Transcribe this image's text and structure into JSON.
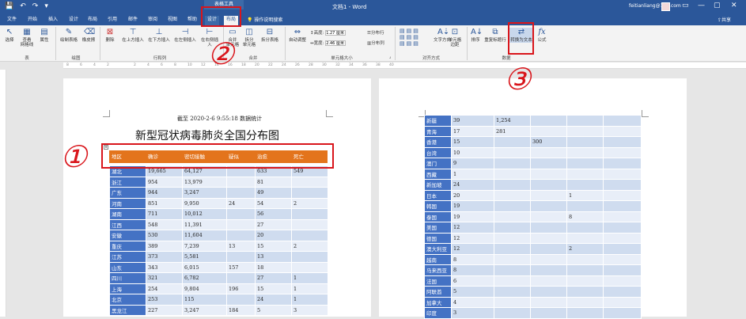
{
  "titlebar": {
    "quick": [
      "💾",
      "↶",
      "↷",
      "▾"
    ],
    "context_label": "表格工具",
    "doc_title": "文档1 - Word",
    "user": "feitianliang@163.com",
    "controls": [
      "▭",
      "—",
      "▢",
      "✕"
    ]
  },
  "tabs": {
    "file": "文件",
    "home": "开始",
    "insert": "插入",
    "design": "设计",
    "layout": "布局",
    "references": "引用",
    "mailings": "邮件",
    "review": "审阅",
    "view": "视图",
    "help": "帮助",
    "tdesign": "设计",
    "tlayout": "布局",
    "tellme": "操作说明搜索",
    "share": "共享"
  },
  "ribbon": {
    "select": "选择",
    "gridlines": "查看\n网格线",
    "properties": "属性",
    "group_table": "表",
    "draw": "绘制表格",
    "eraser": "橡皮擦",
    "group_draw": "绘图",
    "delete": "删除",
    "ins_above": "在上方插入",
    "ins_below": "在下方插入",
    "ins_left": "在左侧插入",
    "ins_right": "在右侧插入",
    "group_rowcol": "行和列",
    "merge": "合并\n单元格",
    "split": "拆分\n单元格",
    "split_table": "拆分表格",
    "group_merge": "合并",
    "autofit": "自动调整",
    "height_label": "高度:",
    "height_value": "1.27 厘米",
    "width_label": "宽度:",
    "width_value": "2.46 厘米",
    "dist_rows": "分布行",
    "dist_cols": "分布列",
    "group_size": "单元格大小",
    "text_dir": "文字方向",
    "margins": "单元格\n边距",
    "group_align": "对齐方式",
    "sort": "排序",
    "repeat_hdr": "重复标题行",
    "convert": "转换为文本",
    "formula": "公式",
    "group_data": "数据"
  },
  "ruler_marks": [
    "8",
    "6",
    "4",
    "2",
    "",
    "2",
    "4",
    "6",
    "8",
    "10",
    "12",
    "14",
    "16",
    "18",
    "20",
    "22",
    "24",
    "26",
    "28",
    "30",
    "32",
    "34",
    "36",
    "38",
    "40"
  ],
  "document": {
    "stamp": "截至 2020-2-6 9:55:18 数据统计",
    "title": "新型冠状病毒肺炎全国分布图",
    "headers": [
      "地区",
      "确诊",
      "密切接触",
      "疑似",
      "治愈",
      "死亡"
    ],
    "rows1": [
      [
        "湖北",
        "19,665",
        "64,127",
        "",
        "633",
        "549"
      ],
      [
        "浙江",
        "954",
        "13,979",
        "",
        "81",
        ""
      ],
      [
        "广东",
        "944",
        "3,247",
        "",
        "49",
        ""
      ],
      [
        "河南",
        "851",
        "9,950",
        "24",
        "54",
        "2"
      ],
      [
        "湖南",
        "711",
        "10,012",
        "",
        "56",
        ""
      ],
      [
        "江西",
        "548",
        "11,391",
        "",
        "27",
        ""
      ],
      [
        "安徽",
        "530",
        "11,604",
        "",
        "20",
        ""
      ],
      [
        "重庆",
        "389",
        "7,239",
        "13",
        "15",
        "2"
      ],
      [
        "江苏",
        "373",
        "5,581",
        "",
        "13",
        ""
      ],
      [
        "山东",
        "343",
        "6,015",
        "157",
        "18",
        ""
      ],
      [
        "四川",
        "321",
        "6,782",
        "",
        "27",
        "1"
      ],
      [
        "上海",
        "254",
        "9,804",
        "196",
        "15",
        "1"
      ],
      [
        "北京",
        "253",
        "115",
        "",
        "24",
        "1"
      ],
      [
        "黑龙江",
        "227",
        "3,247",
        "184",
        "5",
        "3"
      ]
    ],
    "rows2": [
      [
        "新疆",
        "39",
        "1,254",
        "",
        "",
        ""
      ],
      [
        "青海",
        "17",
        "281",
        "",
        "",
        ""
      ],
      [
        "香港",
        "15",
        "",
        "300",
        "",
        ""
      ],
      [
        "台湾",
        "10",
        "",
        "",
        "",
        ""
      ],
      [
        "澳门",
        "9",
        "",
        "",
        "",
        ""
      ],
      [
        "西藏",
        "1",
        "",
        "",
        "",
        ""
      ],
      [
        "新加坡",
        "24",
        "",
        "",
        "",
        ""
      ],
      [
        "日本",
        "20",
        "",
        "",
        "1",
        ""
      ],
      [
        "韩国",
        "19",
        "",
        "",
        "",
        ""
      ],
      [
        "泰国",
        "19",
        "",
        "",
        "8",
        ""
      ],
      [
        "美国",
        "12",
        "",
        "",
        "",
        ""
      ],
      [
        "德国",
        "12",
        "",
        "",
        "",
        ""
      ],
      [
        "澳大利亚",
        "12",
        "",
        "",
        "2",
        ""
      ],
      [
        "越南",
        "8",
        "",
        "",
        "",
        ""
      ],
      [
        "马来西亚",
        "8",
        "",
        "",
        "",
        ""
      ],
      [
        "法国",
        "6",
        "",
        "",
        "",
        ""
      ],
      [
        "阿联酋",
        "5",
        "",
        "",
        "",
        ""
      ],
      [
        "加拿大",
        "4",
        "",
        "",
        "",
        ""
      ],
      [
        "印度",
        "3",
        "",
        "",
        "",
        ""
      ]
    ]
  },
  "annotations": {
    "one": "①",
    "two": "②",
    "three": "③"
  },
  "colors": {
    "brand": "#2b579a",
    "table_first_col": "#4472c4",
    "header_row": "#e3741c",
    "callout": "#d9151b"
  }
}
